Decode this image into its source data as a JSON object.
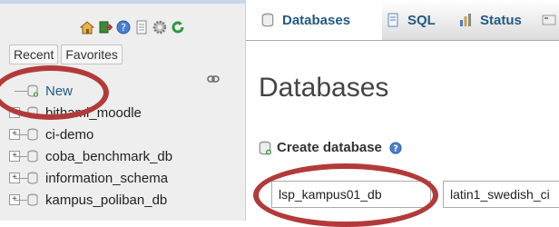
{
  "nav": {
    "toolbar_icons": [
      "home-icon",
      "logout-icon",
      "help-icon",
      "docs-icon",
      "settings-icon",
      "reload-icon"
    ],
    "tabs": [
      {
        "label": "Recent"
      },
      {
        "label": "Favorites"
      }
    ],
    "link_icon": "link-chain-icon",
    "tree": [
      {
        "label": "New",
        "kind": "new"
      },
      {
        "label": "bithami_moodle",
        "kind": "db"
      },
      {
        "label": "ci-demo",
        "kind": "db"
      },
      {
        "label": "coba_benchmark_db",
        "kind": "db"
      },
      {
        "label": "information_schema",
        "kind": "db"
      },
      {
        "label": "kampus_poliban_db",
        "kind": "db"
      }
    ]
  },
  "topbar": {
    "tabs": [
      {
        "label": "Databases",
        "icon": "database-icon",
        "active": true
      },
      {
        "label": "SQL",
        "icon": "sql-icon",
        "active": false
      },
      {
        "label": "Status",
        "icon": "status-icon",
        "active": false
      }
    ]
  },
  "main": {
    "title": "Databases",
    "create_heading": "Create database",
    "db_name_value": "lsp_kampus01_db",
    "collation_value": "latin1_swedish_ci"
  },
  "colors": {
    "annotation": "#b33a3a",
    "link": "#235a81"
  }
}
